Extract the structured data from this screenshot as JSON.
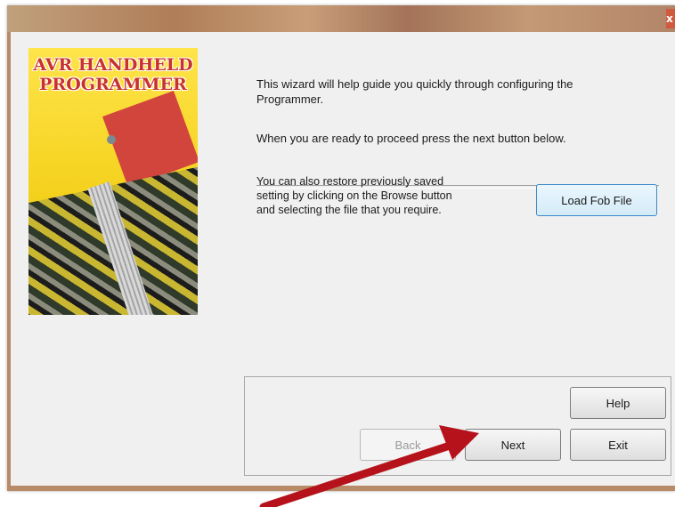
{
  "window": {
    "close_glyph": "x"
  },
  "logo": {
    "line1": "AVR HANDHELD",
    "line2": "PROGRAMMER"
  },
  "intro": {
    "line1": "This wizard will help guide you quickly through configuring the",
    "line2": "Programmer.",
    "proceed": "When you are ready to proceed press the next button below."
  },
  "restore": {
    "line1": "You can also restore previously saved",
    "line2": "setting by clicking on the Browse button",
    "line3": "and selecting the file that you require.",
    "load_button": "Load Fob File"
  },
  "buttons": {
    "help": "Help",
    "back": "Back",
    "next": "Next",
    "exit": "Exit"
  },
  "annotation": {
    "arrow_color": "#b5121b"
  }
}
